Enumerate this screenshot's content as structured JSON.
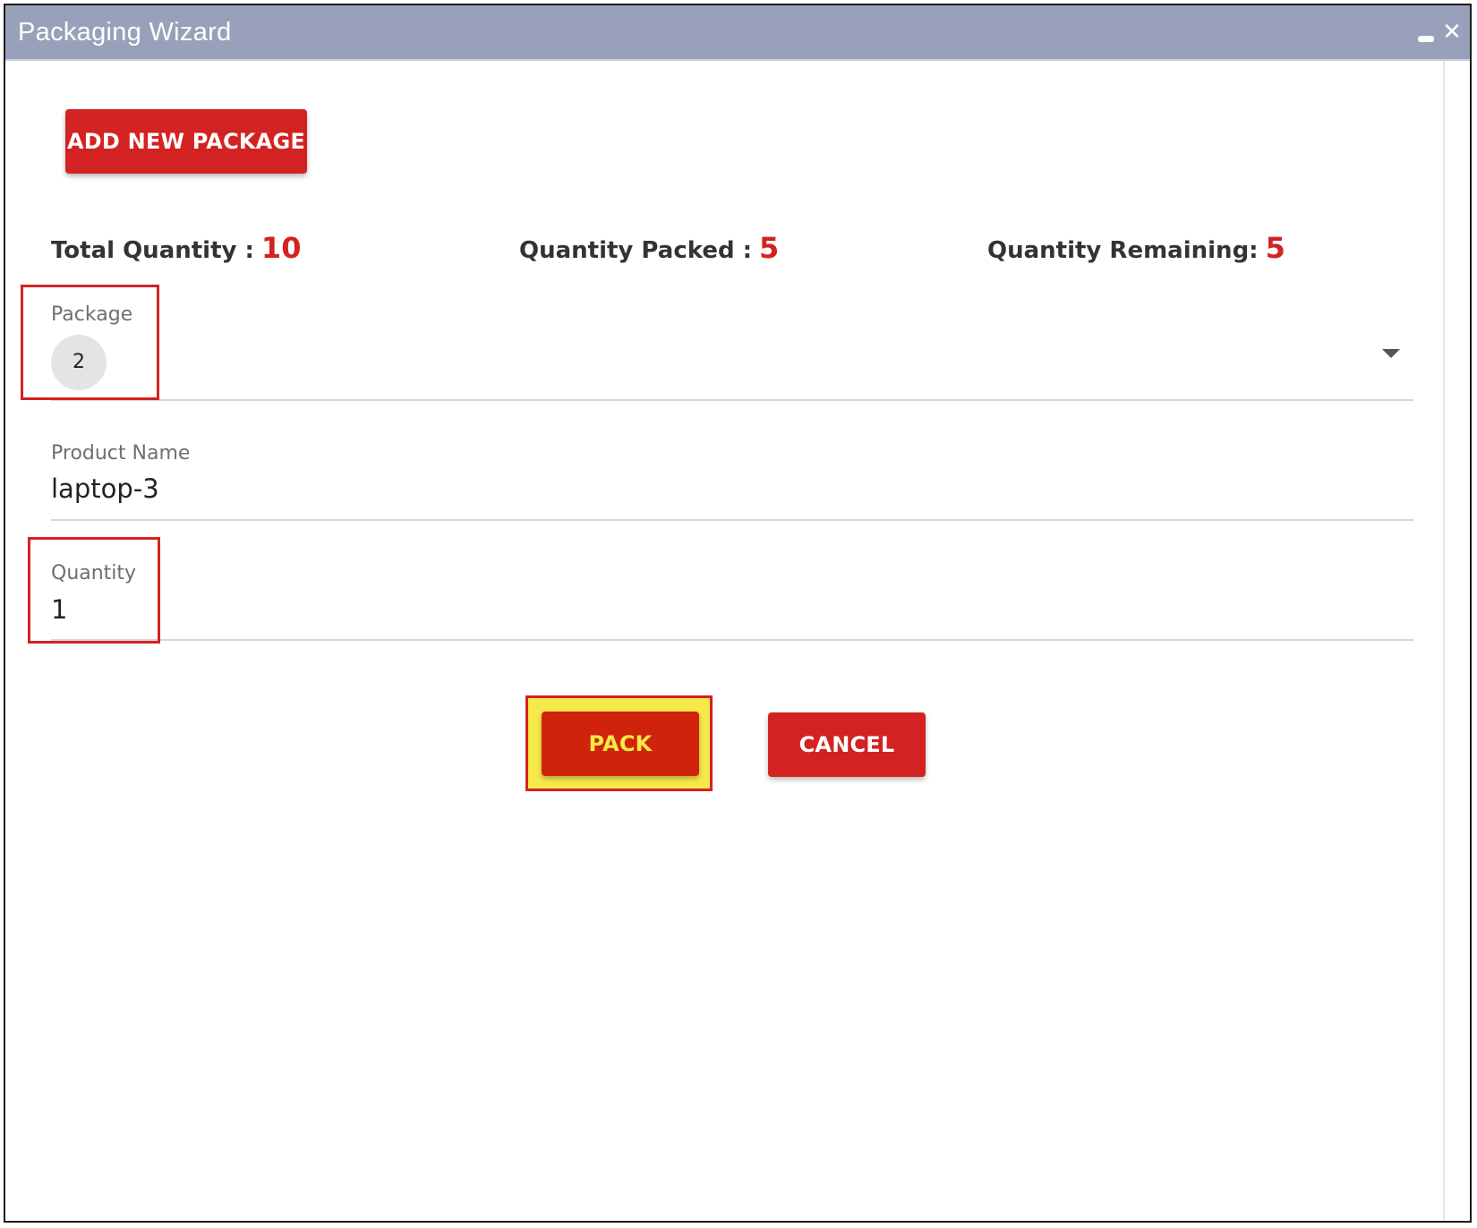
{
  "window": {
    "title": "Packaging Wizard",
    "minimize_icon": "minimize-icon",
    "close_icon": "close-icon",
    "close_glyph": "✕"
  },
  "actions": {
    "add_package_label": "ADD NEW PACKAGE",
    "pack_label": "PACK",
    "cancel_label": "CANCEL"
  },
  "stats": {
    "total_label": "Total Quantity :",
    "total_value": "10",
    "packed_label": "Quantity Packed :",
    "packed_value": "5",
    "remaining_label": "Quantity Remaining:",
    "remaining_value": "5"
  },
  "form": {
    "package": {
      "label": "Package",
      "value": "2"
    },
    "product_name": {
      "label": "Product Name",
      "value": "laptop-3"
    },
    "quantity": {
      "label": "Quantity",
      "value": "1"
    }
  },
  "colors": {
    "accent": "#d32222",
    "titlebar": "#99a1ba",
    "highlight": "#f7e94a"
  }
}
